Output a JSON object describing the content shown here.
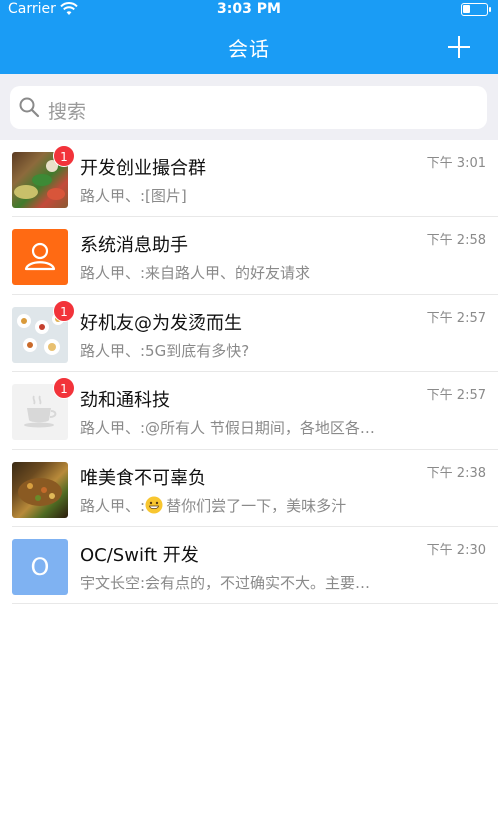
{
  "status": {
    "carrier": "Carrier",
    "time": "3:03 PM",
    "battery_level": 0.3
  },
  "nav": {
    "title": "会话",
    "add_icon": "plus-icon"
  },
  "search": {
    "placeholder": "搜索",
    "icon": "search-icon"
  },
  "colors": {
    "nav_bg": "#1a9cf5",
    "badge": "#f2333a",
    "secondary_text": "#8a8a8a"
  },
  "conversations": [
    {
      "name": "开发创业撮合群",
      "preview": "路人甲、:[图片]",
      "time": "下午 3:01",
      "badge": "1",
      "avatar": "food-photo"
    },
    {
      "name": "系统消息助手",
      "preview": "路人甲、:来自路人甲、的好友请求",
      "time": "下午 2:58",
      "badge": "",
      "avatar": "person-icon"
    },
    {
      "name": "好机友@为发烫而生",
      "preview": "路人甲、:5G到底有多快?",
      "time": "下午 2:57",
      "badge": "1",
      "avatar": "table-photo"
    },
    {
      "name": "劲和通科技",
      "preview": "路人甲、:@所有人 节假日期间，各地区各…",
      "time": "下午 2:57",
      "badge": "1",
      "avatar": "coffee-cup-icon"
    },
    {
      "name": "唯美食不可辜负",
      "preview_emoji": "grinning-emoji",
      "preview": "路人甲、:",
      "preview_rest": "替你们尝了一下，美味多汁",
      "time": "下午 2:38",
      "badge": "",
      "avatar": "food-photo"
    },
    {
      "name": "OC/Swift 开发",
      "preview": "宇文长空:会有点的，不过确实不大。主要…",
      "time": "下午 2:30",
      "badge": "",
      "avatar_letter": "O"
    }
  ]
}
